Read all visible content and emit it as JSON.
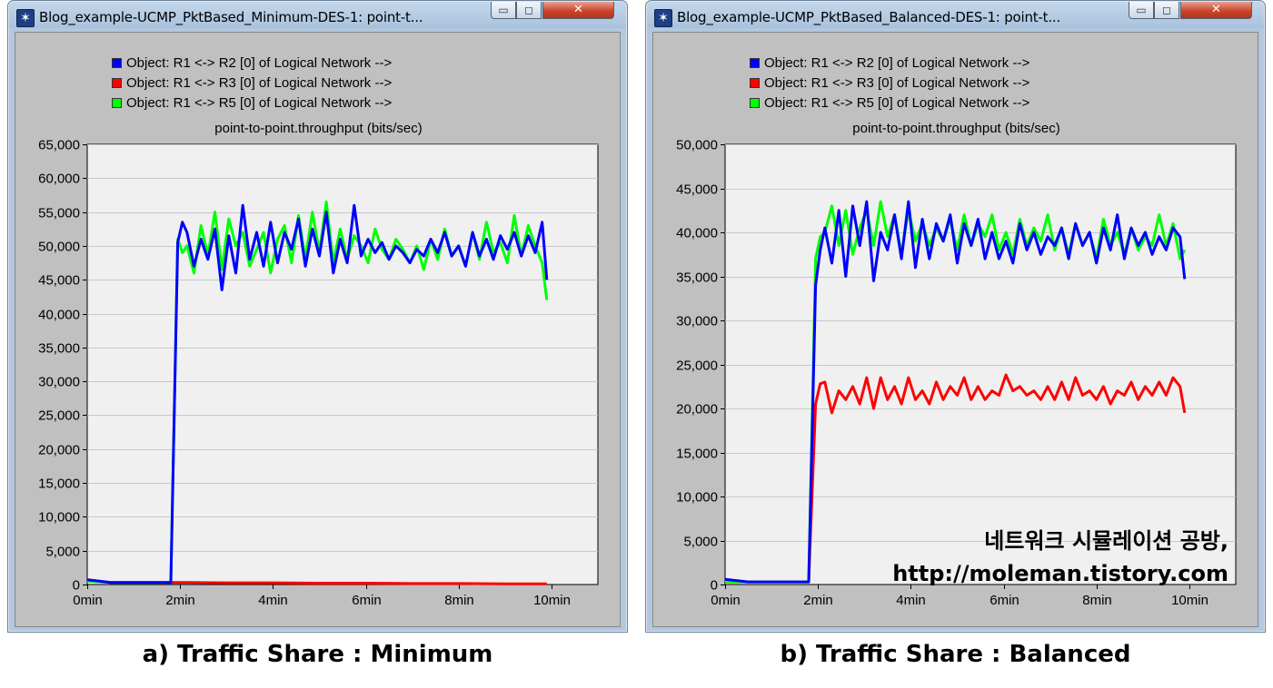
{
  "windows": [
    {
      "title": "Blog_example-UCMP_PktBased_Minimum-DES-1: point-t...",
      "controls": {
        "minimize": "▭",
        "maximize": "◻",
        "close": "✕"
      },
      "legend": [
        {
          "label": "Object: R1 <-> R2 [0] of Logical Network -->",
          "color": "#0000ff"
        },
        {
          "label": "Object: R1 <-> R3 [0] of Logical Network -->",
          "color": "#ff0000"
        },
        {
          "label": "Object: R1 <-> R5 [0] of Logical Network -->",
          "color": "#00ff00"
        }
      ],
      "caption": "a) Traffic Share : Minimum"
    },
    {
      "title": "Blog_example-UCMP_PktBased_Balanced-DES-1: point-t...",
      "controls": {
        "minimize": "▭",
        "maximize": "◻",
        "close": "✕"
      },
      "legend": [
        {
          "label": "Object: R1 <-> R2 [0] of Logical Network -->",
          "color": "#0000ff"
        },
        {
          "label": "Object: R1 <-> R3 [0] of Logical Network -->",
          "color": "#ff0000"
        },
        {
          "label": "Object: R1 <-> R5 [0] of Logical Network -->",
          "color": "#00ff00"
        }
      ],
      "caption": "b) Traffic Share : Balanced",
      "watermark": [
        "네트워크 시뮬레이션 공방,",
        "http://moleman.tistory.com"
      ]
    }
  ],
  "chart_data": [
    {
      "type": "line",
      "title": "point-to-point.throughput (bits/sec)",
      "xlabel": "",
      "ylabel": "",
      "xlim": [
        0,
        11
      ],
      "ylim": [
        0,
        65000
      ],
      "xticks": [
        0,
        2,
        4,
        6,
        8,
        10
      ],
      "xtick_labels": [
        "0min",
        "2min",
        "4min",
        "6min",
        "8min",
        "10min"
      ],
      "yticks": [
        0,
        5000,
        10000,
        15000,
        20000,
        25000,
        30000,
        35000,
        40000,
        45000,
        50000,
        55000,
        60000,
        65000
      ],
      "ytick_labels": [
        "0",
        "5,000",
        "10,000",
        "15,000",
        "20,000",
        "25,000",
        "30,000",
        "35,000",
        "40,000",
        "45,000",
        "50,000",
        "55,000",
        "60,000",
        "65,000"
      ],
      "grid": true,
      "legend_position": "top-left",
      "series": [
        {
          "name": "Object: R1 <-> R3 [0] of Logical Network -->",
          "color": "#ff0000",
          "x": [
            0,
            0.5,
            1.0,
            1.5,
            1.85,
            2.2,
            3.0,
            4.0,
            5.0,
            6.0,
            7.0,
            8.0,
            9.0,
            9.9
          ],
          "y": [
            700,
            300,
            300,
            300,
            300,
            300,
            250,
            250,
            200,
            200,
            150,
            150,
            100,
            100
          ]
        },
        {
          "name": "Object: R1 <-> R5 [0] of Logical Network -->",
          "color": "#00ff00",
          "x": [
            0,
            0.5,
            1.0,
            1.5,
            1.8,
            1.95,
            2.05,
            2.15,
            2.3,
            2.45,
            2.6,
            2.75,
            2.9,
            3.05,
            3.2,
            3.35,
            3.5,
            3.65,
            3.8,
            3.95,
            4.1,
            4.25,
            4.4,
            4.55,
            4.7,
            4.85,
            5.0,
            5.15,
            5.3,
            5.45,
            5.6,
            5.75,
            5.9,
            6.05,
            6.2,
            6.35,
            6.5,
            6.65,
            6.8,
            6.95,
            7.1,
            7.25,
            7.4,
            7.55,
            7.7,
            7.85,
            8.0,
            8.15,
            8.3,
            8.45,
            8.6,
            8.75,
            8.9,
            9.05,
            9.2,
            9.35,
            9.5,
            9.65,
            9.8,
            9.9
          ],
          "y": [
            500,
            300,
            300,
            300,
            300,
            51000,
            49000,
            50000,
            46000,
            53000,
            48500,
            55000,
            46500,
            54000,
            50000,
            52000,
            47000,
            49500,
            52000,
            46000,
            51000,
            53000,
            47500,
            54500,
            48000,
            55000,
            49000,
            56500,
            47500,
            52500,
            48000,
            51500,
            50000,
            47500,
            52500,
            49500,
            48000,
            51000,
            49500,
            47500,
            50000,
            46500,
            51000,
            48000,
            52500,
            48500,
            50000,
            47000,
            52000,
            48000,
            53500,
            49000,
            50500,
            47500,
            54500,
            48500,
            53000,
            50000,
            47500,
            42000
          ]
        },
        {
          "name": "Object: R1 <-> R2 [0] of Logical Network -->",
          "color": "#0000ff",
          "x": [
            0,
            0.5,
            1.0,
            1.5,
            1.8,
            1.95,
            2.05,
            2.15,
            2.3,
            2.45,
            2.6,
            2.75,
            2.9,
            3.05,
            3.2,
            3.35,
            3.5,
            3.65,
            3.8,
            3.95,
            4.1,
            4.25,
            4.4,
            4.55,
            4.7,
            4.85,
            5.0,
            5.15,
            5.3,
            5.45,
            5.6,
            5.75,
            5.9,
            6.05,
            6.2,
            6.35,
            6.5,
            6.65,
            6.8,
            6.95,
            7.1,
            7.25,
            7.4,
            7.55,
            7.7,
            7.85,
            8.0,
            8.15,
            8.3,
            8.45,
            8.6,
            8.75,
            8.9,
            9.05,
            9.2,
            9.35,
            9.5,
            9.65,
            9.8,
            9.9
          ],
          "y": [
            700,
            300,
            300,
            300,
            300,
            50500,
            53500,
            52000,
            47000,
            51000,
            48000,
            52500,
            43500,
            51500,
            46000,
            56000,
            48000,
            52000,
            47000,
            53500,
            47500,
            52000,
            49500,
            54000,
            47000,
            52500,
            48500,
            55000,
            46000,
            51000,
            47500,
            56000,
            48500,
            51000,
            49000,
            50500,
            48000,
            50000,
            49000,
            47500,
            49500,
            48500,
            51000,
            49000,
            52000,
            48500,
            50000,
            47000,
            52000,
            48500,
            51000,
            48000,
            51500,
            49500,
            52000,
            48500,
            51500,
            49000,
            53500,
            45000
          ]
        }
      ]
    },
    {
      "type": "line",
      "title": "point-to-point.throughput (bits/sec)",
      "xlabel": "",
      "ylabel": "",
      "xlim": [
        0,
        11
      ],
      "ylim": [
        0,
        50000
      ],
      "xticks": [
        0,
        2,
        4,
        6,
        8,
        10
      ],
      "xtick_labels": [
        "0min",
        "2min",
        "4min",
        "6min",
        "8min",
        "10min"
      ],
      "yticks": [
        0,
        5000,
        10000,
        15000,
        20000,
        25000,
        30000,
        35000,
        40000,
        45000,
        50000
      ],
      "ytick_labels": [
        "0",
        "5,000",
        "10,000",
        "15,000",
        "20,000",
        "25,000",
        "30,000",
        "35,000",
        "40,000",
        "45,000",
        "50,000"
      ],
      "grid": true,
      "legend_position": "top-left",
      "series": [
        {
          "name": "Object: R1 <-> R3 [0] of Logical Network -->",
          "color": "#ff0000",
          "x": [
            0,
            0.5,
            1.0,
            1.5,
            1.8,
            1.95,
            2.05,
            2.15,
            2.3,
            2.45,
            2.6,
            2.75,
            2.9,
            3.05,
            3.2,
            3.35,
            3.5,
            3.65,
            3.8,
            3.95,
            4.1,
            4.25,
            4.4,
            4.55,
            4.7,
            4.85,
            5.0,
            5.15,
            5.3,
            5.45,
            5.6,
            5.75,
            5.9,
            6.05,
            6.2,
            6.35,
            6.5,
            6.65,
            6.8,
            6.95,
            7.1,
            7.25,
            7.4,
            7.55,
            7.7,
            7.85,
            8.0,
            8.15,
            8.3,
            8.45,
            8.6,
            8.75,
            8.9,
            9.05,
            9.2,
            9.35,
            9.5,
            9.65,
            9.8,
            9.9
          ],
          "y": [
            300,
            300,
            300,
            300,
            300,
            20500,
            22800,
            23000,
            19500,
            22000,
            21000,
            22500,
            20500,
            23500,
            20000,
            23500,
            21000,
            22500,
            20500,
            23500,
            21000,
            22000,
            20500,
            23000,
            21000,
            22500,
            21500,
            23500,
            21000,
            22500,
            21000,
            22000,
            21500,
            23800,
            22000,
            22500,
            21500,
            22000,
            21000,
            22500,
            21000,
            23000,
            21000,
            23500,
            21500,
            22000,
            21000,
            22500,
            20500,
            22000,
            21500,
            23000,
            21000,
            22500,
            21500,
            23000,
            21500,
            23500,
            22500,
            19500
          ]
        },
        {
          "name": "Object: R1 <-> R5 [0] of Logical Network -->",
          "color": "#00ff00",
          "x": [
            0,
            0.5,
            1.0,
            1.5,
            1.8,
            1.95,
            2.05,
            2.15,
            2.3,
            2.45,
            2.6,
            2.75,
            2.9,
            3.05,
            3.2,
            3.35,
            3.5,
            3.65,
            3.8,
            3.95,
            4.1,
            4.25,
            4.4,
            4.55,
            4.7,
            4.85,
            5.0,
            5.15,
            5.3,
            5.45,
            5.6,
            5.75,
            5.9,
            6.05,
            6.2,
            6.35,
            6.5,
            6.65,
            6.8,
            6.95,
            7.1,
            7.25,
            7.4,
            7.55,
            7.7,
            7.85,
            8.0,
            8.15,
            8.3,
            8.45,
            8.6,
            8.75,
            8.9,
            9.05,
            9.2,
            9.35,
            9.5,
            9.65,
            9.8,
            9.9
          ],
          "y": [
            300,
            300,
            300,
            300,
            300,
            37000,
            39500,
            40000,
            43000,
            38500,
            42500,
            37500,
            40500,
            42500,
            38500,
            43500,
            39500,
            42000,
            37500,
            42500,
            39000,
            41000,
            38500,
            40500,
            39000,
            41500,
            38000,
            42000,
            38500,
            41000,
            39500,
            42000,
            38000,
            40000,
            37500,
            41500,
            38500,
            40500,
            39000,
            42000,
            38000,
            40500,
            37500,
            41000,
            38500,
            40000,
            37000,
            41500,
            38500,
            40000,
            37500,
            40500,
            38000,
            39500,
            38500,
            42000,
            38500,
            41000,
            37000,
            38000
          ]
        },
        {
          "name": "Object: R1 <-> R2 [0] of Logical Network -->",
          "color": "#0000ff",
          "x": [
            0,
            0.5,
            1.0,
            1.5,
            1.8,
            1.95,
            2.05,
            2.15,
            2.3,
            2.45,
            2.6,
            2.75,
            2.9,
            3.05,
            3.2,
            3.35,
            3.5,
            3.65,
            3.8,
            3.95,
            4.1,
            4.25,
            4.4,
            4.55,
            4.7,
            4.85,
            5.0,
            5.15,
            5.3,
            5.45,
            5.6,
            5.75,
            5.9,
            6.05,
            6.2,
            6.35,
            6.5,
            6.65,
            6.8,
            6.95,
            7.1,
            7.25,
            7.4,
            7.55,
            7.7,
            7.85,
            8.0,
            8.15,
            8.3,
            8.45,
            8.6,
            8.75,
            8.9,
            9.05,
            9.2,
            9.35,
            9.5,
            9.65,
            9.8,
            9.9
          ],
          "y": [
            600,
            300,
            300,
            300,
            300,
            34000,
            38000,
            40500,
            36500,
            42500,
            35000,
            43000,
            38500,
            43500,
            34500,
            40000,
            38000,
            42000,
            37000,
            43500,
            36000,
            41500,
            37000,
            41000,
            39000,
            42000,
            36500,
            41000,
            38500,
            41500,
            37000,
            40000,
            37000,
            39000,
            36500,
            41000,
            38000,
            40000,
            37500,
            39500,
            38500,
            40500,
            37000,
            41000,
            38500,
            40000,
            36500,
            40500,
            38000,
            42000,
            37000,
            40500,
            38500,
            40000,
            37500,
            39500,
            38000,
            40500,
            39500,
            34700
          ]
        }
      ]
    }
  ]
}
